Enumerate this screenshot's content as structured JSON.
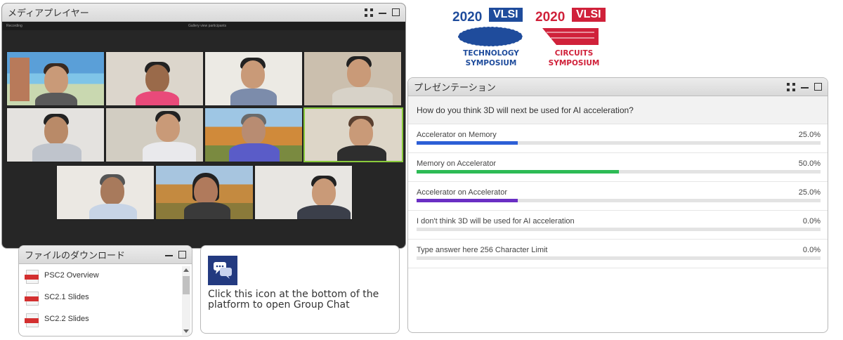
{
  "media_player": {
    "title": "メディアプレイヤー",
    "strip_left": "Recording",
    "strip_center": "Gallery view participants"
  },
  "logos": {
    "technology": {
      "year": "2020",
      "badge": "VLSI",
      "line1": "TECHNOLOGY",
      "line2": "SYMPOSIUM",
      "color": "#1f4c9c"
    },
    "circuits": {
      "year": "2020",
      "badge": "VLSI",
      "line1": "CIRCUITS",
      "line2": "SYMPOSIUM",
      "color": "#d0213a"
    }
  },
  "presentation": {
    "title": "プレゼンテーション",
    "question": "How do you think 3D will next be used for AI acceleration?",
    "options": [
      {
        "label": "Accelerator on Memory",
        "percent_text": "25.0%",
        "value": 25.0,
        "color": "#2d5fd6"
      },
      {
        "label": "Memory on Accelerator",
        "percent_text": "50.0%",
        "value": 50.0,
        "color": "#2dbb55"
      },
      {
        "label": "Accelerator on Accelerator",
        "percent_text": "25.0%",
        "value": 25.0,
        "color": "#6a2fc4"
      },
      {
        "label": "I don't think 3D will be used for AI acceleration",
        "percent_text": "0.0%",
        "value": 0.0,
        "color": "#9e9e9e"
      },
      {
        "label": "Type answer here 256 Character Limit",
        "percent_text": "0.0%",
        "value": 0.0,
        "color": "#9e9e9e"
      }
    ]
  },
  "downloads": {
    "title": "ファイルのダウンロード",
    "files": [
      "PSC2 Overview",
      "SC2.1 Slides",
      "SC2.2 Slides"
    ]
  },
  "chat_hint": {
    "text": "Click this icon at the bottom of the platform to open Group Chat",
    "icon_color": "#233a80"
  }
}
